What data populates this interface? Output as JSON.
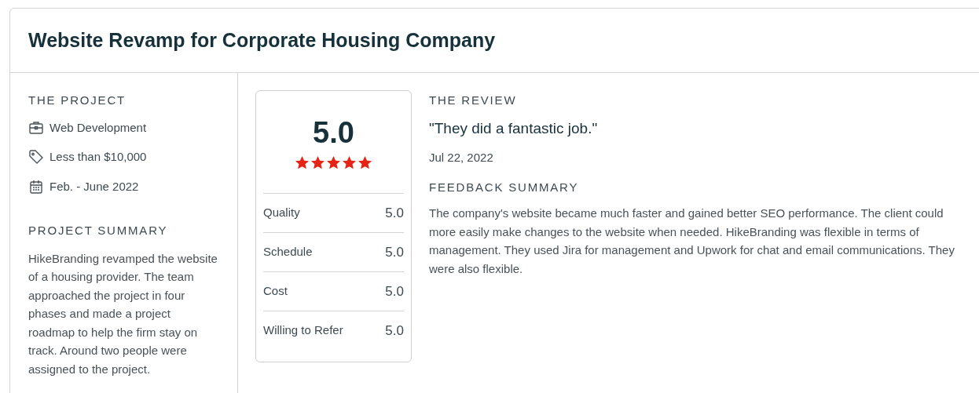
{
  "title": "Website Revamp for Corporate Housing Company",
  "project": {
    "heading": "THE PROJECT",
    "details": [
      {
        "kind": "service",
        "text": "Web Development"
      },
      {
        "kind": "budget",
        "text": "Less than $10,000"
      },
      {
        "kind": "dates",
        "text": "Feb. - June 2022"
      }
    ],
    "summary_heading": "PROJECT SUMMARY",
    "summary": "HikeBranding revamped the website of a housing provider. The team approached the project in four phases and made a project roadmap to help the firm stay on track. Around two people were assigned to the project."
  },
  "rating": {
    "overall": "5.0",
    "stars": 5,
    "scores": [
      {
        "label": "Quality",
        "value": "5.0"
      },
      {
        "label": "Schedule",
        "value": "5.0"
      },
      {
        "label": "Cost",
        "value": "5.0"
      },
      {
        "label": "Willing to Refer",
        "value": "5.0"
      }
    ]
  },
  "review": {
    "heading": "THE REVIEW",
    "quote": "\"They did a fantastic job.\"",
    "date": "Jul 22, 2022",
    "feedback_heading": "FEEDBACK SUMMARY",
    "feedback": "The company's website became much faster and gained better SEO performance. The client could more easily make changes to the website when needed. HikeBranding was flexible in terms of management. They used Jira for management and Upwork for chat and email communications. They were also flexible."
  }
}
